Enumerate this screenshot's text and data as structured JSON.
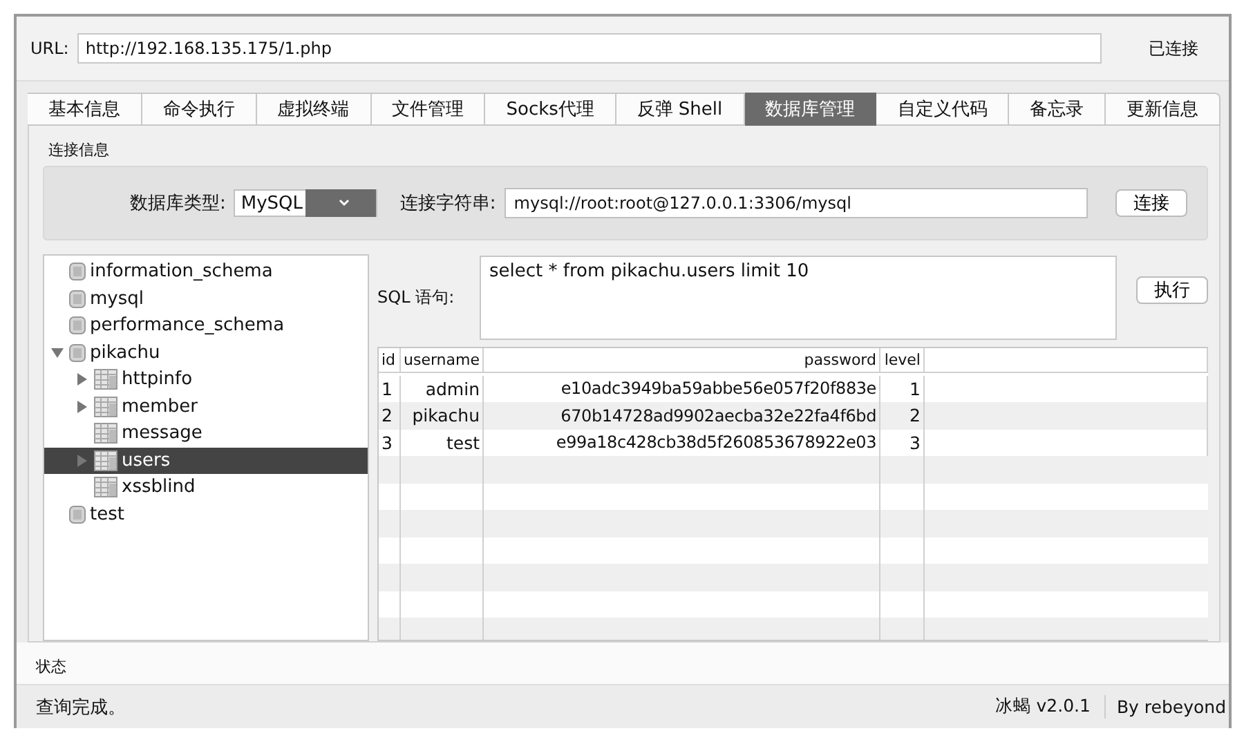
{
  "url_bar": {
    "label": "URL:",
    "value": "http://192.168.135.175/1.php",
    "status": "已连接"
  },
  "tabs": [
    {
      "label": "基本信息",
      "selected": false
    },
    {
      "label": "命令执行",
      "selected": false
    },
    {
      "label": "虚拟终端",
      "selected": false
    },
    {
      "label": "文件管理",
      "selected": false
    },
    {
      "label": "Socks代理",
      "selected": false
    },
    {
      "label": "反弹 Shell",
      "selected": false
    },
    {
      "label": "数据库管理",
      "selected": true
    },
    {
      "label": "自定义代码",
      "selected": false
    },
    {
      "label": "备忘录",
      "selected": false
    },
    {
      "label": "更新信息",
      "selected": false
    }
  ],
  "connection": {
    "section_title": "连接信息",
    "db_type_label": "数据库类型:",
    "db_type": "MySQL",
    "conn_string_label": "连接字符串:",
    "conn_string": "mysql://root:root@127.0.0.1:3306/mysql",
    "connect_button": "连接"
  },
  "tree": [
    {
      "name": "information_schema",
      "kind": "database",
      "selected": false
    },
    {
      "name": "mysql",
      "kind": "database",
      "selected": false
    },
    {
      "name": "performance_schema",
      "kind": "database",
      "selected": false
    },
    {
      "name": "pikachu",
      "kind": "database",
      "expanded": true,
      "selected": false,
      "children": [
        {
          "name": "httpinfo",
          "kind": "table",
          "expanded": false,
          "selected": false
        },
        {
          "name": "member",
          "kind": "table",
          "expanded": false,
          "selected": false
        },
        {
          "name": "message",
          "kind": "table",
          "selected": false
        },
        {
          "name": "users",
          "kind": "table",
          "expanded": false,
          "selected": true
        },
        {
          "name": "xssblind",
          "kind": "table",
          "selected": false
        }
      ]
    },
    {
      "name": "test",
      "kind": "database",
      "selected": false
    }
  ],
  "sql": {
    "label": "SQL 语句:",
    "query": "select * from pikachu.users limit 10",
    "run_button": "执行"
  },
  "table": {
    "columns": [
      "id",
      "username",
      "password",
      "level"
    ],
    "rows": [
      [
        "1",
        "admin",
        "e10adc3949ba59abbe56e057f20f883e",
        "1"
      ],
      [
        "2",
        "pikachu",
        "670b14728ad9902aecba32e22fa4f6bd",
        "2"
      ],
      [
        "3",
        "test",
        "e99a18c428cb38d5f260853678922e03",
        "3"
      ]
    ]
  },
  "status": {
    "section_title": "状态",
    "message": "查询完成。",
    "version": "冰蝎 v2.0.1",
    "author": "By rebeyond"
  }
}
